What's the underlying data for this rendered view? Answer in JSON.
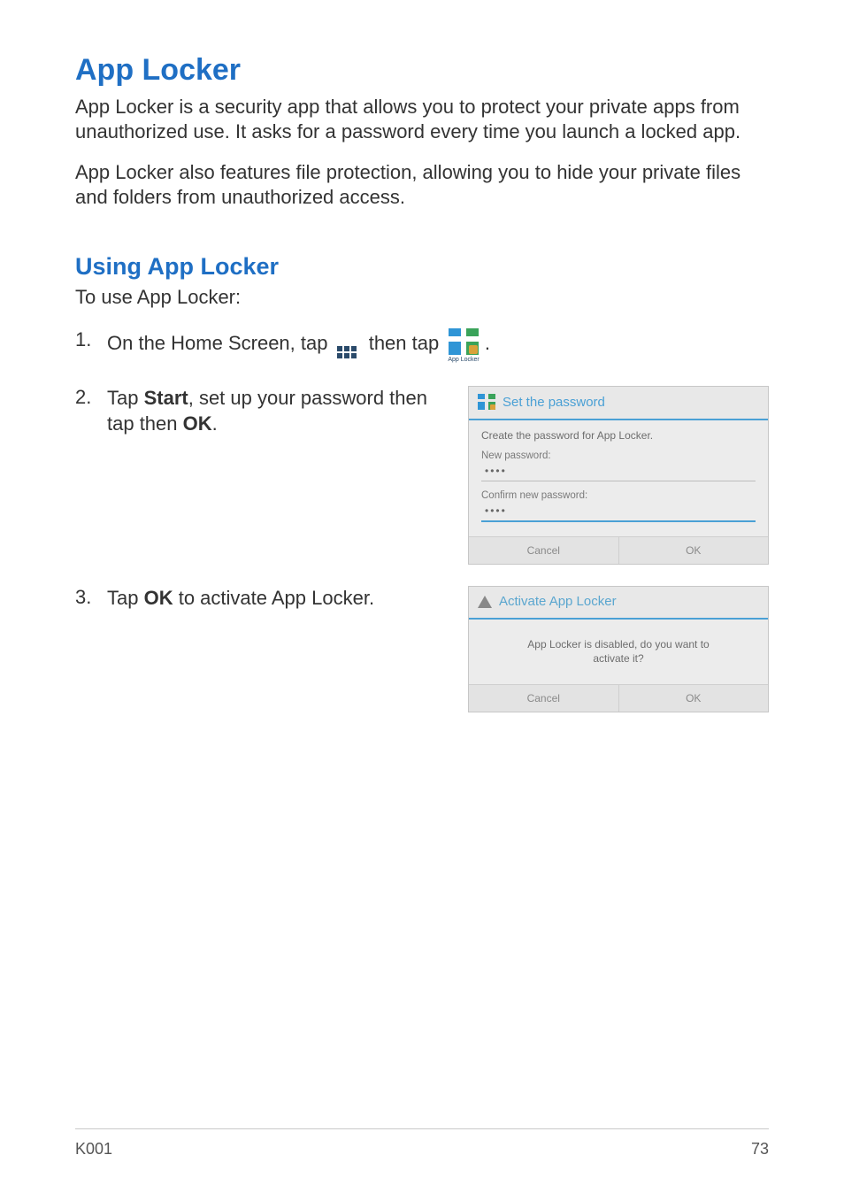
{
  "title": "App Locker",
  "intro_p1": "App Locker is a security app that allows you to protect your private apps from unauthorized use. It asks for a password every time you launch a locked app.",
  "intro_p2": "App Locker also features file protection, allowing you to hide your private files and folders from unauthorized access.",
  "subheading": "Using App Locker",
  "lead": "To use App Locker:",
  "step1_a": "On the Home Screen, tap ",
  "step1_b": " then tap ",
  "step1_c": ".",
  "locker_caption": "App Locker",
  "step2_a": "Tap ",
  "step2_start": "Start",
  "step2_b": ", set up your password then tap then ",
  "step2_ok": "OK",
  "step2_c": ".",
  "step3_a": "Tap ",
  "step3_ok": "OK",
  "step3_b": " to activate App Locker.",
  "dialog1": {
    "title": "Set the password",
    "instruction": "Create the password for App Locker.",
    "new_pw_label": "New password:",
    "new_pw_value": "••••",
    "confirm_label": "Confirm new password:",
    "confirm_value": "••••",
    "cancel": "Cancel",
    "ok": "OK"
  },
  "dialog2": {
    "title": "Activate App Locker",
    "message": "App Locker is disabled, do you want to activate it?",
    "cancel": "Cancel",
    "ok": "OK"
  },
  "footer": {
    "model": "K001",
    "page": "73"
  }
}
